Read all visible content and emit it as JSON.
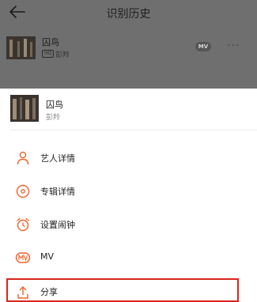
{
  "header": {
    "title": "识别历史"
  },
  "history_item": {
    "name": "囚鸟",
    "quality_badge": "HQ",
    "artist": "彭羚",
    "mv_badge": "MV",
    "more": "···"
  },
  "sheet": {
    "song": {
      "name": "囚鸟",
      "artist": "彭羚"
    },
    "menu": [
      {
        "label": "艺人详情",
        "icon": "artist-icon"
      },
      {
        "label": "专辑详情",
        "icon": "album-icon"
      },
      {
        "label": "设置闹钟",
        "icon": "alarm-clock-icon"
      },
      {
        "label": "MV",
        "icon": "mv-icon"
      },
      {
        "label": "分享",
        "icon": "share-icon"
      }
    ]
  },
  "colors": {
    "accent": "#f0622b",
    "overlay": "#6f6f6f",
    "highlight": "#d9261c"
  }
}
